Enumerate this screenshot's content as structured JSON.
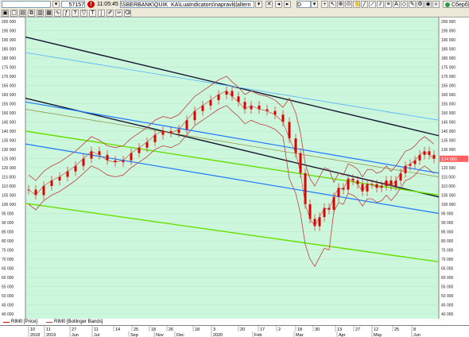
{
  "toolbar": {
    "instrument_value": "",
    "quantity": "57157",
    "clock": "11:05:45",
    "script_path": "\\SBERBANK\\QUIK_KA\\LuaIndicators\\napravlenie-1-arp.lua 35",
    "script_mode": "altern",
    "period": "D",
    "sber_label": "Сберб"
  },
  "chart": {
    "y_ticks": [
      200000,
      195000,
      190000,
      185000,
      180000,
      175000,
      170000,
      165000,
      160000,
      155000,
      150000,
      145000,
      140000,
      135000,
      130000,
      125000,
      120000,
      115000,
      110000,
      105000,
      100000,
      95000,
      90000,
      85000,
      80000,
      75000,
      70000,
      65000,
      60000,
      55000,
      50000,
      45000,
      40000
    ],
    "y_tick_labels": [
      "200 000",
      "195 000",
      "190 000",
      "185 000",
      "180 000",
      "175 000",
      "170 000",
      "165 000",
      "160 000",
      "155 000",
      "150 000",
      "145 000",
      "140 000",
      "135 000",
      "130 000",
      "125 000",
      "120 000",
      "115 000",
      "110 000",
      "105 000",
      "100 000",
      "95 000",
      "90 000",
      "85 000",
      "80 000",
      "75 000",
      "70 000",
      "65 000",
      "60 000",
      "55 000",
      "50 000",
      "45 000",
      "40 000"
    ],
    "price_tag": "124 880",
    "colors": {
      "background": "#ccf7dc",
      "candle": "#e00000",
      "bollinger": "#c04040",
      "channel_black": "#151530",
      "channel_blue": "#1e78ff",
      "channel_lightblue": "#50b0ff",
      "channel_green": "#66e000",
      "channel_olive": "#909040",
      "price_tag_bg": "#ff6060"
    }
  },
  "chart_data": {
    "type": "line",
    "title": "",
    "series": [
      {
        "name": "RIM0 [Price]"
      },
      {
        "name": "RIM0 [Bollinger Bands]"
      }
    ],
    "ylim": [
      40000,
      200000
    ],
    "last_price": 124880
  },
  "legend": {
    "price_label": "RIM0 [Price]",
    "bollinger_label": "RIM0 [Bollinger Bands]"
  },
  "xaxis": {
    "days": [
      "10",
      "11",
      "27",
      "11",
      "14",
      "25",
      "18",
      "26",
      "18",
      "3",
      "20",
      "17",
      "2",
      "18",
      "30",
      "13",
      "27",
      "12",
      "25",
      "8"
    ],
    "months": [
      "2018",
      "2019",
      "Jun",
      "Jul",
      "Sep",
      "Nov",
      "Dec",
      "2020",
      "Feb",
      "Mar",
      "Apr",
      "May",
      "Jun"
    ]
  }
}
